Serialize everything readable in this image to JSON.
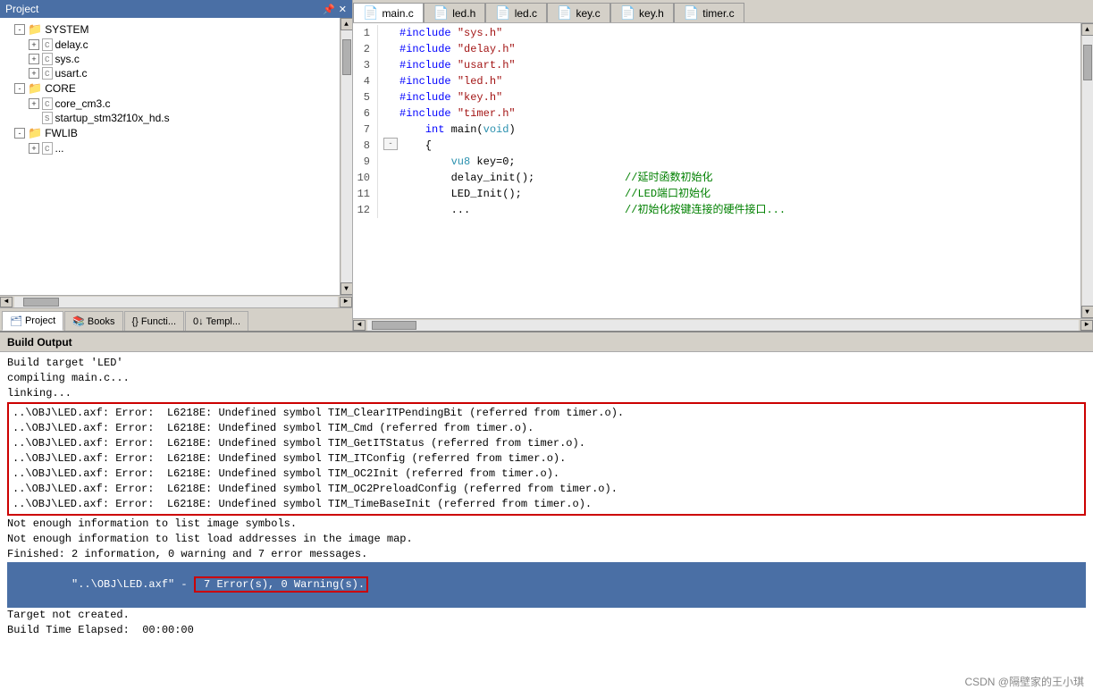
{
  "project": {
    "title": "Project",
    "pin_icon": "📌",
    "close_icon": "✕",
    "tree": [
      {
        "id": "system-folder",
        "label": "SYSTEM",
        "type": "folder",
        "indent": 1,
        "expanded": true
      },
      {
        "id": "delay-c",
        "label": "delay.c",
        "type": "file",
        "indent": 2
      },
      {
        "id": "sys-c",
        "label": "sys.c",
        "type": "file",
        "indent": 2
      },
      {
        "id": "usart-c",
        "label": "usart.c",
        "type": "file",
        "indent": 2
      },
      {
        "id": "core-folder",
        "label": "CORE",
        "type": "folder",
        "indent": 1,
        "expanded": true
      },
      {
        "id": "core-cm3-c",
        "label": "core_cm3.c",
        "type": "file",
        "indent": 2
      },
      {
        "id": "startup-s",
        "label": "startup_stm32f10x_hd.s",
        "type": "file",
        "indent": 2
      },
      {
        "id": "fwlib-folder",
        "label": "FWLIB",
        "type": "folder",
        "indent": 1,
        "expanded": true
      }
    ],
    "bottom_tabs": [
      {
        "id": "project-tab",
        "label": "Project",
        "icon": "🗂",
        "active": true
      },
      {
        "id": "books-tab",
        "label": "Books",
        "icon": "📚",
        "active": false
      },
      {
        "id": "functions-tab",
        "label": "{} Functi...",
        "icon": "",
        "active": false
      },
      {
        "id": "templates-tab",
        "label": "0↓ Templ...",
        "icon": "",
        "active": false
      }
    ]
  },
  "editor": {
    "tabs": [
      {
        "id": "main-c",
        "label": "main.c",
        "type": "c",
        "active": true
      },
      {
        "id": "led-h",
        "label": "led.h",
        "type": "h",
        "active": false
      },
      {
        "id": "led-c",
        "label": "led.c",
        "type": "c",
        "active": false
      },
      {
        "id": "key-c",
        "label": "key.c",
        "type": "c",
        "active": false
      },
      {
        "id": "key-h",
        "label": "key.h",
        "type": "h",
        "active": false
      },
      {
        "id": "timer-c",
        "label": "timer.c",
        "type": "c",
        "active": false
      }
    ],
    "lines": [
      {
        "num": "1",
        "content": "#include \"sys.h\"",
        "type": "include"
      },
      {
        "num": "2",
        "content": "#include \"delay.h\"",
        "type": "include"
      },
      {
        "num": "3",
        "content": "#include \"usart.h\"",
        "type": "include"
      },
      {
        "num": "4",
        "content": "#include \"led.h\"",
        "type": "include"
      },
      {
        "num": "5",
        "content": "#include \"key.h\"",
        "type": "include"
      },
      {
        "num": "6",
        "content": "#include \"timer.h\"",
        "type": "include"
      },
      {
        "num": "7",
        "content": "    int main(void)",
        "type": "normal"
      },
      {
        "num": "8",
        "content": "    {",
        "type": "fold",
        "fold": true
      },
      {
        "num": "9",
        "content": "        vu8 key=0;",
        "type": "normal"
      },
      {
        "num": "10",
        "content": "        delay_init();              //延时函数初始化",
        "type": "comment"
      },
      {
        "num": "11",
        "content": "        LED_Init();                //LED端口初始化",
        "type": "comment"
      },
      {
        "num": "12",
        "content": "        ...",
        "type": "comment_partial"
      }
    ]
  },
  "build": {
    "title": "Build Output",
    "lines": [
      {
        "id": "build-target",
        "text": "Build target 'LED'",
        "type": "normal"
      },
      {
        "id": "compiling",
        "text": "compiling main.c...",
        "type": "normal"
      },
      {
        "id": "linking",
        "text": "linking...",
        "type": "normal"
      },
      {
        "id": "error1",
        "text": "..\\OBJ\\LED.axf: Error:  L6218E: Undefined symbol TIM_ClearITPendingBit (referred from timer.o).",
        "type": "error"
      },
      {
        "id": "error2",
        "text": "..\\OBJ\\LED.axf: Error:  L6218E: Undefined symbol TIM_Cmd (referred from timer.o).",
        "type": "error"
      },
      {
        "id": "error3",
        "text": "..\\OBJ\\LED.axf: Error:  L6218E: Undefined symbol TIM_GetITStatus (referred from timer.o).",
        "type": "error"
      },
      {
        "id": "error4",
        "text": "..\\OBJ\\LED.axf: Error:  L6218E: Undefined symbol TIM_ITConfig (referred from timer.o).",
        "type": "error"
      },
      {
        "id": "error5",
        "text": "..\\OBJ\\LED.axf: Error:  L6218E: Undefined symbol TIM_OC2Init (referred from timer.o).",
        "type": "error"
      },
      {
        "id": "error6",
        "text": "..\\OBJ\\LED.axf: Error:  L6218E: Undefined symbol TIM_OC2PreloadConfig (referred from timer.o).",
        "type": "error"
      },
      {
        "id": "error7",
        "text": "..\\OBJ\\LED.axf: Error:  L6218E: Undefined symbol TIM_TimeBaseInit (referred from timer.o).",
        "type": "error"
      },
      {
        "id": "info1",
        "text": "Not enough information to list image symbols.",
        "type": "normal"
      },
      {
        "id": "info2",
        "text": "Not enough information to list load addresses in the image map.",
        "type": "normal"
      },
      {
        "id": "finished",
        "text": "Finished: 2 information, 0 warning and 7 error messages.",
        "type": "normal"
      },
      {
        "id": "summary",
        "text": "\"..\\OBJ\\LED.axf\" -  7 Error(s), 0 Warning(s).",
        "type": "selected",
        "prefix": "\"..\\OBJ\\LED.axf\" - ",
        "highlight": " 7 Error(s), 0 Warning(s)."
      },
      {
        "id": "not-created",
        "text": "Target not created.",
        "type": "normal"
      },
      {
        "id": "build-time",
        "text": "Build Time Elapsed:  00:00:00",
        "type": "normal"
      }
    ]
  },
  "watermark": {
    "text": "CSDN @隔壁家的王小琪"
  }
}
